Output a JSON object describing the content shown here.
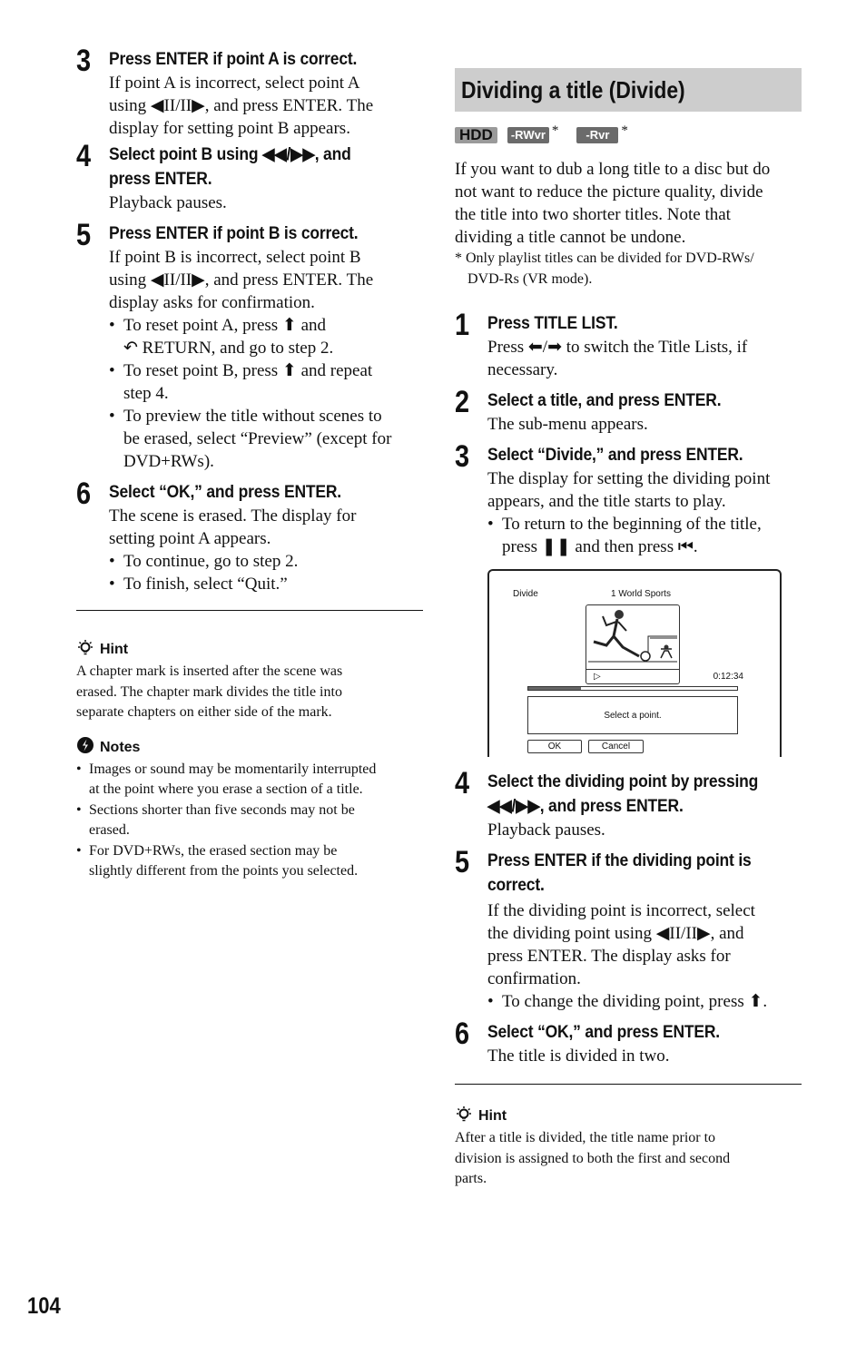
{
  "left": {
    "steps": [
      {
        "num": "3",
        "title": "Press ENTER if point A is correct.",
        "body_lines": [
          "If point A is incorrect, select point A",
          "using ◀II/II▶, and press ENTER. The",
          "display for setting point B appears."
        ]
      },
      {
        "num": "4",
        "title_lines": [
          "Select point B using ◀◀/▶▶, and",
          "press ENTER."
        ],
        "body": "Playback pauses."
      },
      {
        "num": "5",
        "title": "Press ENTER if point B is correct.",
        "body_lines": [
          "If point B is incorrect, select point B",
          "using ◀II/II▶, and press ENTER. The",
          "display asks for confirmation."
        ],
        "bullets": [
          [
            "To reset point A, press ⬆ and",
            "↶ RETURN, and go to step 2."
          ],
          [
            "To reset point B, press ⬆ and repeat",
            "step 4."
          ],
          [
            "To preview the title without scenes to",
            "be erased, select “Preview” (except for",
            "DVD+RWs)."
          ]
        ]
      },
      {
        "num": "6",
        "title": "Select “OK,” and press ENTER.",
        "body_lines": [
          "The scene is erased. The display for",
          "setting point A appears."
        ],
        "bullets": [
          [
            "To continue, go to step 2."
          ],
          [
            "To finish, select “Quit.”"
          ]
        ]
      }
    ],
    "hint": {
      "label": "Hint",
      "lines": [
        "A chapter mark is inserted after the scene was",
        "erased. The chapter mark divides the title into",
        "separate chapters on either side of the mark."
      ]
    },
    "notes": {
      "label": "Notes",
      "items": [
        [
          "Images or sound may be momentarily interrupted",
          "at the point where you erase a section of a title."
        ],
        [
          "Sections shorter than five seconds may not be",
          "erased."
        ],
        [
          "For DVD+RWs, the erased section may be",
          "slightly different from the points you selected."
        ]
      ]
    }
  },
  "right": {
    "section_title": "Dividing a title (Divide)",
    "badges": [
      {
        "label": "HDD",
        "asterisk": ""
      },
      {
        "label": "-RWvr",
        "asterisk": "*"
      },
      {
        "label": "-Rvr",
        "asterisk": "*"
      }
    ],
    "intro_lines": [
      "If you want to dub a long title to a disc but do",
      "not want to reduce the picture quality, divide",
      "the title into two shorter titles. Note that",
      "dividing a title cannot be undone."
    ],
    "footnote_lines": [
      "* Only playlist titles can be divided for DVD-RWs/",
      "DVD-Rs (VR mode)."
    ],
    "steps": [
      {
        "num": "1",
        "title": "Press TITLE LIST.",
        "body_lines": [
          "Press ⬅/➡ to switch the Title Lists, if",
          "necessary."
        ]
      },
      {
        "num": "2",
        "title": "Select a title, and press ENTER.",
        "body": "The sub-menu appears."
      },
      {
        "num": "3",
        "title": "Select “Divide,” and press ENTER.",
        "body_lines": [
          "The display for setting the dividing point",
          "appears, and the title starts to play."
        ],
        "bullets": [
          [
            "To return to the beginning of the title,",
            "press ❚❚ and then press ⏮."
          ]
        ]
      },
      {
        "num": "4",
        "title_lines": [
          "Select the dividing point by pressing",
          "◀◀/▶▶, and press ENTER."
        ],
        "body": "Playback pauses."
      },
      {
        "num": "5",
        "title_lines": [
          "Press ENTER if the dividing point is",
          "correct."
        ],
        "body_lines": [
          "If the dividing point is incorrect, select",
          "the dividing point using ◀II/II▶, and",
          "press ENTER. The display asks for",
          "confirmation."
        ],
        "bullets": [
          [
            "To change the dividing point, press ⬆."
          ]
        ]
      },
      {
        "num": "6",
        "title": "Select “OK,” and press ENTER.",
        "body": "The title is divided in two."
      }
    ],
    "screen": {
      "label": "Divide",
      "title": "1 World Sports",
      "time": "0:12:34",
      "progress_fraction": 0.25,
      "message": "Select a point.",
      "ok": "OK",
      "cancel": "Cancel"
    },
    "hint": {
      "label": "Hint",
      "lines": [
        "After a title is divided, the title name prior to",
        "division is assigned to both the first and second",
        "parts."
      ]
    }
  },
  "page_number": "104"
}
